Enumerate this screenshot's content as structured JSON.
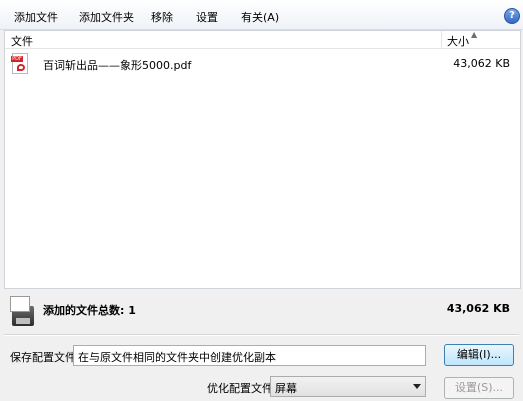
{
  "menu": {
    "add_file": "添加文件",
    "add_folder": "添加文件夹",
    "remove": "移除",
    "settings": "设置",
    "about": "有关(A)",
    "help_icon": "?"
  },
  "list": {
    "col_file": "文件",
    "col_size": "大小",
    "files": [
      {
        "name": "百词斩出品——象形5000.pdf",
        "size": "43,062 KB",
        "icon": "pdf-icon",
        "icon_tag": "PDF"
      }
    ]
  },
  "summary": {
    "label": "添加的文件总数: 1",
    "size": "43,062 KB",
    "icon": "optimizer-disk-icon"
  },
  "save_config": {
    "label": "保存配置文件",
    "value": "在与原文件相同的文件夹中创建优化副本",
    "edit_button": "编辑(I)..."
  },
  "optimize": {
    "label": "优化配置文件:",
    "selected": "屏幕",
    "settings_button": "设置(S)..."
  },
  "colors": {
    "pdf_red": "#d3262b",
    "accent_blue": "#3c7fb1"
  }
}
